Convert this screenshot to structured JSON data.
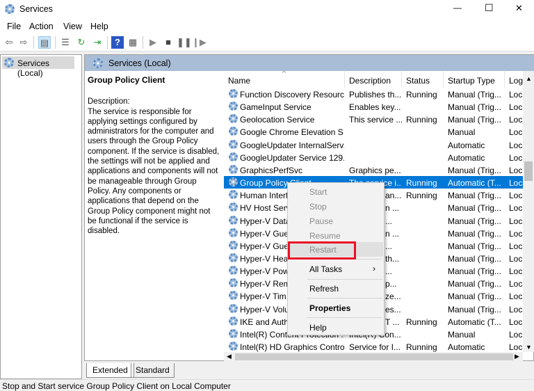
{
  "window": {
    "title": "Services",
    "controls": {
      "minimize": "—",
      "maximize": "☐",
      "close": "✕"
    }
  },
  "menu": [
    "File",
    "Action",
    "View",
    "Help"
  ],
  "toolbar": [
    "back-icon",
    "forward-icon",
    "show-hide-console-tree-icon",
    "properties-icon",
    "refresh-icon",
    "export-list-icon",
    "help-icon",
    "show-action-pane-icon",
    "start-service-icon",
    "stop-service-icon",
    "pause-service-icon",
    "restart-service-icon"
  ],
  "tree": {
    "item": "Services (Local)"
  },
  "pane": {
    "title": "Services (Local)"
  },
  "detail": {
    "name": "Group Policy Client",
    "label": "Description:",
    "text": "The service is responsible for applying settings configured by administrators for the computer and users through the Group Policy component. If the service is disabled, the settings will not be applied and applications and components will not be manageable through Group Policy. Any components or applications that depend on the Group Policy component might not be functional if the service is disabled."
  },
  "columns": [
    "Name",
    "Description",
    "Status",
    "Startup Type",
    "Log"
  ],
  "rows": [
    [
      "Function Discovery Resourc...",
      "Publishes th...",
      "Running",
      "Manual (Trig...",
      "Loca"
    ],
    [
      "GameInput Service",
      "Enables key...",
      "",
      "Manual (Trig...",
      "Loca"
    ],
    [
      "Geolocation Service",
      "This service ...",
      "Running",
      "Manual (Trig...",
      "Loca"
    ],
    [
      "Google Chrome Elevation S...",
      "",
      "",
      "Manual",
      "Loca"
    ],
    [
      "GoogleUpdater InternalServ...",
      "",
      "",
      "Automatic",
      "Loca"
    ],
    [
      "GoogleUpdater Service 129....",
      "",
      "",
      "Automatic",
      "Loca"
    ],
    [
      "GraphicsPerfSvc",
      "Graphics pe...",
      "",
      "Manual (Trig...",
      "Loca"
    ],
    [
      "Group Policy Client",
      "The service i...",
      "Running",
      "Automatic (T...",
      "Loca"
    ],
    [
      "Human Interf",
      "an...",
      "Running",
      "Manual (Trig...",
      "Loca"
    ],
    [
      "HV Host Serv",
      "n ...",
      "",
      "Manual (Trig...",
      "Loca"
    ],
    [
      "Hyper-V Data",
      "...",
      "",
      "Manual (Trig...",
      "Loca"
    ],
    [
      "Hyper-V Gue",
      "n ...",
      "",
      "Manual (Trig...",
      "Loca"
    ],
    [
      "Hyper-V Gue",
      "...",
      "",
      "Manual (Trig...",
      "Loca"
    ],
    [
      "Hyper-V Hea",
      "th...",
      "",
      "Manual (Trig...",
      "Loca"
    ],
    [
      "Hyper-V Pow",
      "...",
      "",
      "Manual (Trig...",
      "Loca"
    ],
    [
      "Hyper-V Rem",
      "p...",
      "",
      "Manual (Trig...",
      "Loca"
    ],
    [
      "Hyper-V Tim",
      "ze...",
      "",
      "Manual (Trig...",
      "Loca"
    ],
    [
      "Hyper-V Volu",
      "es...",
      "",
      "Manual (Trig...",
      "Loca"
    ],
    [
      "IKE and Auth",
      "T ...",
      "Running",
      "Automatic (T...",
      "Loca"
    ],
    [
      "Intel(R) Content Protection ...",
      "Intel(R) Con...",
      "",
      "Manual",
      "Loca"
    ],
    [
      "Intel(R) HD Graphics Contro...",
      "Service for I...",
      "Running",
      "Automatic",
      "Loca"
    ]
  ],
  "selected_row": 7,
  "context_menu": {
    "items": [
      {
        "label": "Start",
        "disabled": true
      },
      {
        "label": "Stop",
        "disabled": true
      },
      {
        "label": "Pause",
        "disabled": true
      },
      {
        "label": "Resume",
        "disabled": true
      },
      {
        "label": "Restart",
        "disabled": true,
        "highlighted": true
      },
      {
        "label": "All Tasks",
        "submenu": true
      },
      {
        "label": "Refresh"
      },
      {
        "label": "Properties",
        "bold": true
      },
      {
        "label": "Help"
      }
    ]
  },
  "tabs": [
    "Extended",
    "Standard"
  ],
  "status": "Stop and Start service Group Policy Client on Local Computer",
  "colors": {
    "selection": "#0078d7",
    "band": "#a9bdd6",
    "highlight_box": "#e81123"
  }
}
